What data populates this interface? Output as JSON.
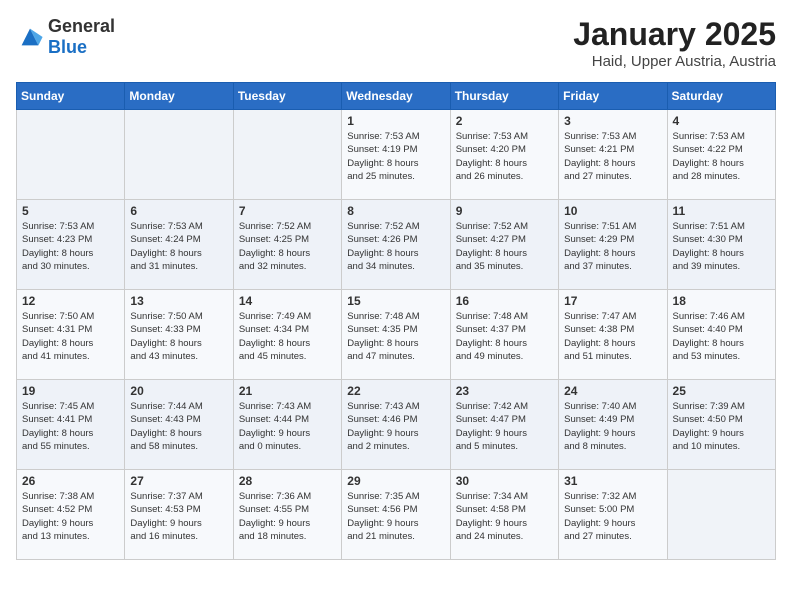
{
  "logo": {
    "general": "General",
    "blue": "Blue"
  },
  "title": "January 2025",
  "location": "Haid, Upper Austria, Austria",
  "weekdays": [
    "Sunday",
    "Monday",
    "Tuesday",
    "Wednesday",
    "Thursday",
    "Friday",
    "Saturday"
  ],
  "weeks": [
    [
      {
        "day": "",
        "info": ""
      },
      {
        "day": "",
        "info": ""
      },
      {
        "day": "",
        "info": ""
      },
      {
        "day": "1",
        "info": "Sunrise: 7:53 AM\nSunset: 4:19 PM\nDaylight: 8 hours\nand 25 minutes."
      },
      {
        "day": "2",
        "info": "Sunrise: 7:53 AM\nSunset: 4:20 PM\nDaylight: 8 hours\nand 26 minutes."
      },
      {
        "day": "3",
        "info": "Sunrise: 7:53 AM\nSunset: 4:21 PM\nDaylight: 8 hours\nand 27 minutes."
      },
      {
        "day": "4",
        "info": "Sunrise: 7:53 AM\nSunset: 4:22 PM\nDaylight: 8 hours\nand 28 minutes."
      }
    ],
    [
      {
        "day": "5",
        "info": "Sunrise: 7:53 AM\nSunset: 4:23 PM\nDaylight: 8 hours\nand 30 minutes."
      },
      {
        "day": "6",
        "info": "Sunrise: 7:53 AM\nSunset: 4:24 PM\nDaylight: 8 hours\nand 31 minutes."
      },
      {
        "day": "7",
        "info": "Sunrise: 7:52 AM\nSunset: 4:25 PM\nDaylight: 8 hours\nand 32 minutes."
      },
      {
        "day": "8",
        "info": "Sunrise: 7:52 AM\nSunset: 4:26 PM\nDaylight: 8 hours\nand 34 minutes."
      },
      {
        "day": "9",
        "info": "Sunrise: 7:52 AM\nSunset: 4:27 PM\nDaylight: 8 hours\nand 35 minutes."
      },
      {
        "day": "10",
        "info": "Sunrise: 7:51 AM\nSunset: 4:29 PM\nDaylight: 8 hours\nand 37 minutes."
      },
      {
        "day": "11",
        "info": "Sunrise: 7:51 AM\nSunset: 4:30 PM\nDaylight: 8 hours\nand 39 minutes."
      }
    ],
    [
      {
        "day": "12",
        "info": "Sunrise: 7:50 AM\nSunset: 4:31 PM\nDaylight: 8 hours\nand 41 minutes."
      },
      {
        "day": "13",
        "info": "Sunrise: 7:50 AM\nSunset: 4:33 PM\nDaylight: 8 hours\nand 43 minutes."
      },
      {
        "day": "14",
        "info": "Sunrise: 7:49 AM\nSunset: 4:34 PM\nDaylight: 8 hours\nand 45 minutes."
      },
      {
        "day": "15",
        "info": "Sunrise: 7:48 AM\nSunset: 4:35 PM\nDaylight: 8 hours\nand 47 minutes."
      },
      {
        "day": "16",
        "info": "Sunrise: 7:48 AM\nSunset: 4:37 PM\nDaylight: 8 hours\nand 49 minutes."
      },
      {
        "day": "17",
        "info": "Sunrise: 7:47 AM\nSunset: 4:38 PM\nDaylight: 8 hours\nand 51 minutes."
      },
      {
        "day": "18",
        "info": "Sunrise: 7:46 AM\nSunset: 4:40 PM\nDaylight: 8 hours\nand 53 minutes."
      }
    ],
    [
      {
        "day": "19",
        "info": "Sunrise: 7:45 AM\nSunset: 4:41 PM\nDaylight: 8 hours\nand 55 minutes."
      },
      {
        "day": "20",
        "info": "Sunrise: 7:44 AM\nSunset: 4:43 PM\nDaylight: 8 hours\nand 58 minutes."
      },
      {
        "day": "21",
        "info": "Sunrise: 7:43 AM\nSunset: 4:44 PM\nDaylight: 9 hours\nand 0 minutes."
      },
      {
        "day": "22",
        "info": "Sunrise: 7:43 AM\nSunset: 4:46 PM\nDaylight: 9 hours\nand 2 minutes."
      },
      {
        "day": "23",
        "info": "Sunrise: 7:42 AM\nSunset: 4:47 PM\nDaylight: 9 hours\nand 5 minutes."
      },
      {
        "day": "24",
        "info": "Sunrise: 7:40 AM\nSunset: 4:49 PM\nDaylight: 9 hours\nand 8 minutes."
      },
      {
        "day": "25",
        "info": "Sunrise: 7:39 AM\nSunset: 4:50 PM\nDaylight: 9 hours\nand 10 minutes."
      }
    ],
    [
      {
        "day": "26",
        "info": "Sunrise: 7:38 AM\nSunset: 4:52 PM\nDaylight: 9 hours\nand 13 minutes."
      },
      {
        "day": "27",
        "info": "Sunrise: 7:37 AM\nSunset: 4:53 PM\nDaylight: 9 hours\nand 16 minutes."
      },
      {
        "day": "28",
        "info": "Sunrise: 7:36 AM\nSunset: 4:55 PM\nDaylight: 9 hours\nand 18 minutes."
      },
      {
        "day": "29",
        "info": "Sunrise: 7:35 AM\nSunset: 4:56 PM\nDaylight: 9 hours\nand 21 minutes."
      },
      {
        "day": "30",
        "info": "Sunrise: 7:34 AM\nSunset: 4:58 PM\nDaylight: 9 hours\nand 24 minutes."
      },
      {
        "day": "31",
        "info": "Sunrise: 7:32 AM\nSunset: 5:00 PM\nDaylight: 9 hours\nand 27 minutes."
      },
      {
        "day": "",
        "info": ""
      }
    ]
  ]
}
